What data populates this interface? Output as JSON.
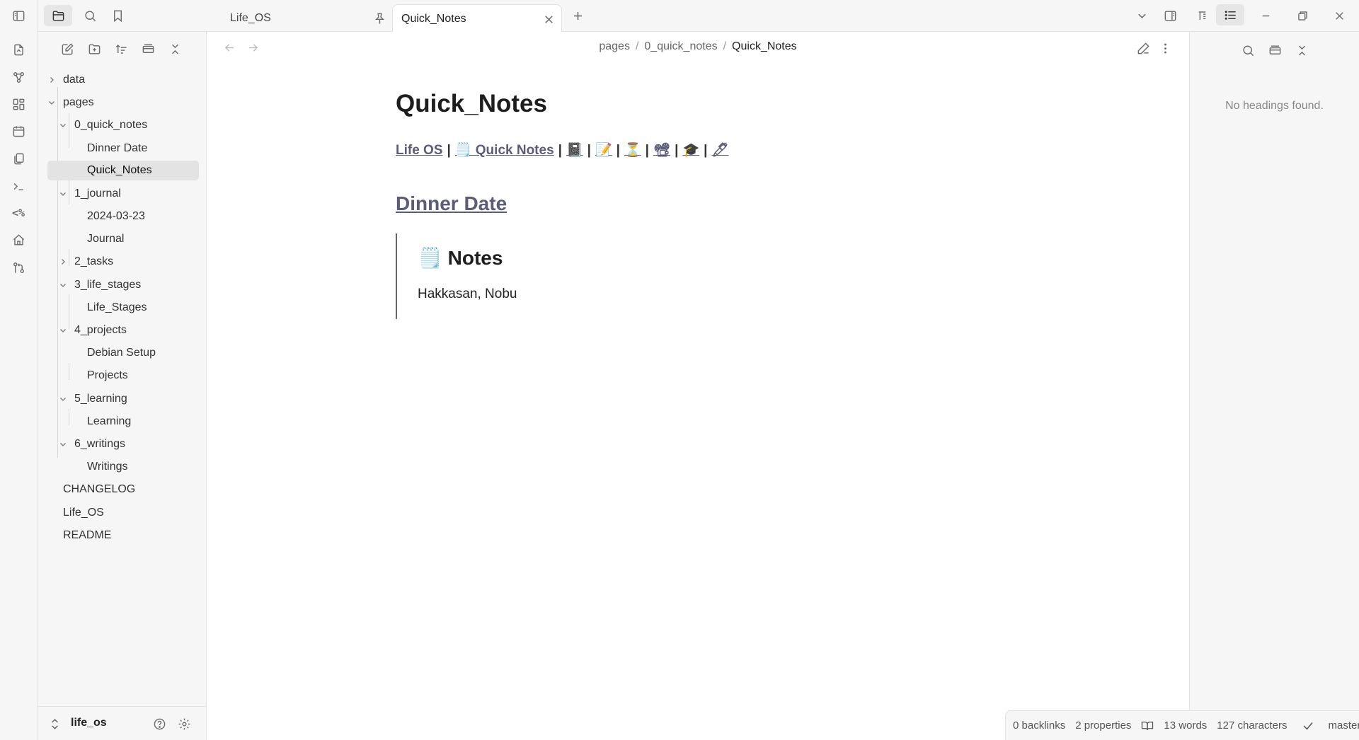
{
  "tabs": [
    {
      "label": "Life_OS",
      "pinned": true
    },
    {
      "label": "Quick_Notes",
      "active": true
    }
  ],
  "breadcrumb": [
    "pages",
    "0_quick_notes",
    "Quick_Notes"
  ],
  "tree": [
    {
      "label": "data",
      "depth": 0,
      "folder": true,
      "expanded": false
    },
    {
      "label": "pages",
      "depth": 0,
      "folder": true,
      "expanded": true
    },
    {
      "label": "0_quick_notes",
      "depth": 1,
      "folder": true,
      "expanded": true
    },
    {
      "label": "Dinner Date",
      "depth": 2
    },
    {
      "label": "Quick_Notes",
      "depth": 2,
      "selected": true
    },
    {
      "label": "1_journal",
      "depth": 1,
      "folder": true,
      "expanded": true
    },
    {
      "label": "2024-03-23",
      "depth": 2
    },
    {
      "label": "Journal",
      "depth": 2
    },
    {
      "label": "2_tasks",
      "depth": 1,
      "folder": true,
      "expanded": false
    },
    {
      "label": "3_life_stages",
      "depth": 1,
      "folder": true,
      "expanded": true
    },
    {
      "label": "Life_Stages",
      "depth": 2
    },
    {
      "label": "4_projects",
      "depth": 1,
      "folder": true,
      "expanded": true
    },
    {
      "label": "Debian Setup",
      "depth": 2
    },
    {
      "label": "Projects",
      "depth": 2
    },
    {
      "label": "5_learning",
      "depth": 1,
      "folder": true,
      "expanded": true
    },
    {
      "label": "Learning",
      "depth": 2
    },
    {
      "label": "6_writings",
      "depth": 1,
      "folder": true,
      "expanded": true
    },
    {
      "label": "Writings",
      "depth": 2
    },
    {
      "label": "CHANGELOG",
      "depth": 0
    },
    {
      "label": "Life_OS",
      "depth": 0
    },
    {
      "label": "README",
      "depth": 0
    }
  ],
  "vault": {
    "name": "life_os"
  },
  "note": {
    "title": "Quick_Notes",
    "nav_links": [
      "Life OS",
      "🗒️ Quick Notes",
      "📓",
      "📝",
      "⏳",
      "📽",
      "🎓",
      "🖊"
    ],
    "heading_link": "Dinner Date",
    "callout_title": "🗒️ Notes",
    "callout_text": "Hakkasan, Nobu"
  },
  "outline": {
    "empty_text": "No headings found."
  },
  "status": {
    "backlinks": "0 backlinks",
    "properties": "2 properties",
    "words": "13 words",
    "characters": "127 characters",
    "branch": "master"
  },
  "colors": {
    "accent_link": "#5b5b7a",
    "sidebar_bg": "#f6f6f6",
    "selected_bg": "#e3e3e3"
  }
}
